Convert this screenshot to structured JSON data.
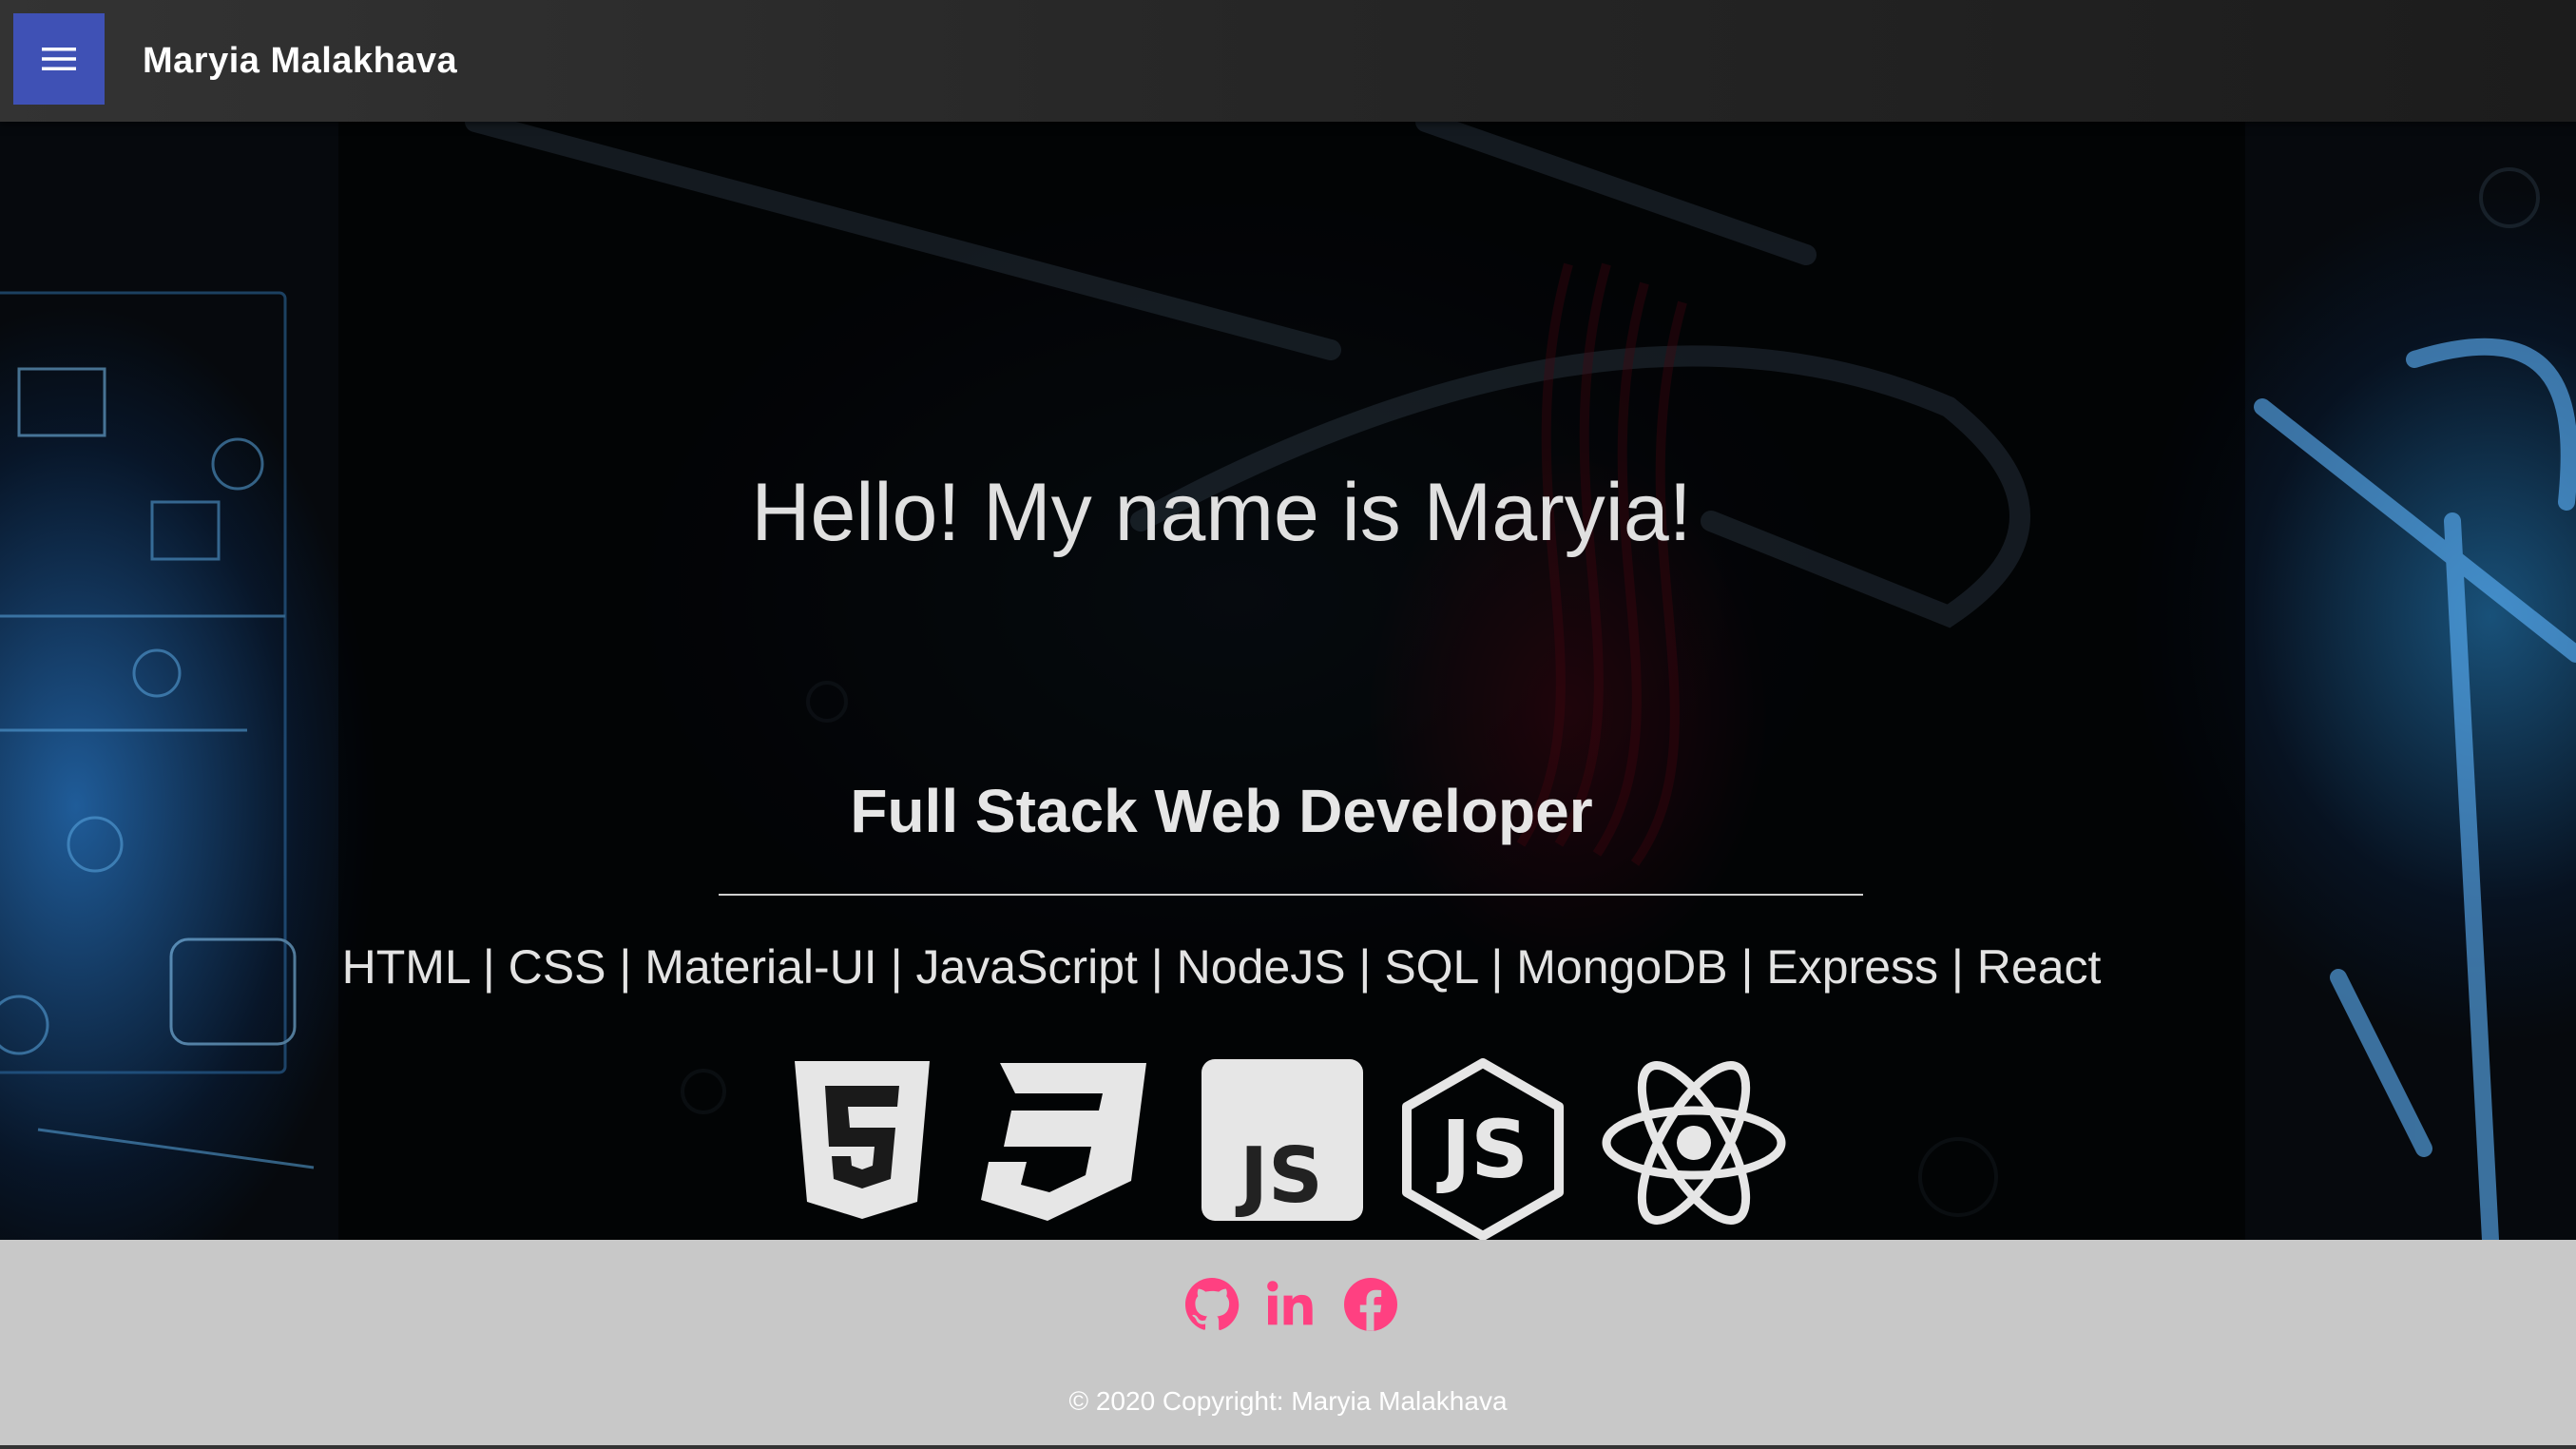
{
  "appbar": {
    "title": "Maryia Malakhava",
    "menu_icon": "hamburger-menu-icon",
    "menu_color": "#3f51b5"
  },
  "hero": {
    "greeting": "Hello! My name is Maryia!",
    "role": "Full Stack Web Developer",
    "skills": "HTML | CSS | Material-UI | JavaScript | NodeJS | SQL | MongoDB | Express | React",
    "tech_icons": [
      "html5-icon",
      "css3-icon",
      "javascript-icon",
      "nodejs-icon",
      "react-icon"
    ],
    "icon_text": {
      "js": "JS"
    }
  },
  "footer": {
    "social_icons": [
      "github-icon",
      "linkedin-icon",
      "facebook-icon"
    ],
    "social_color": "#ff4081",
    "copyright": "© 2020 Copyright: Maryia Malakhava"
  }
}
